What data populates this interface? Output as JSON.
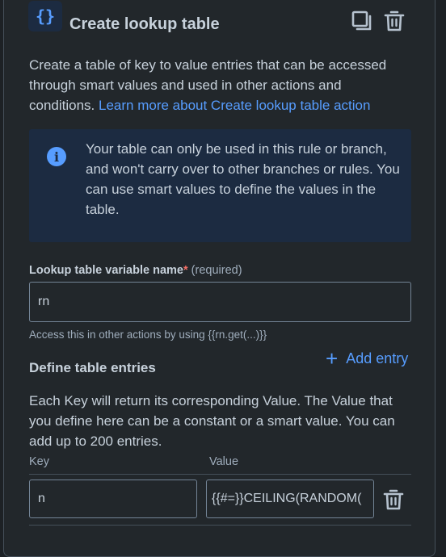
{
  "header": {
    "icon_glyph": "{}",
    "icon_name": "curly-braces-icon",
    "title": "Create lookup table"
  },
  "description": {
    "text": "Create a table of key to value entries that can be accessed through smart values and used in other actions and conditions. ",
    "link_text": "Learn more about Create lookup table action"
  },
  "info": {
    "icon_glyph": "i",
    "text": "Your table can only be used in this rule or branch, and won't carry over to other branches or rules. You can use smart values to define the values in the table."
  },
  "variable_field": {
    "label": "Lookup table variable name",
    "required_star": "*",
    "required_text": "(required)",
    "value": "rn",
    "helper": "Access this in other actions by using {{rn.get(...)}}"
  },
  "entries": {
    "title": "Define table entries",
    "add_label": "Add entry",
    "add_glyph": "+",
    "description": "Each Key will return its corresponding Value. The Value that you define here can be a constant or a smart value. You can add up to 200 entries.",
    "column_key": "Key",
    "column_value": "Value",
    "rows": [
      {
        "key": "n",
        "value": "{{#=}}CEILING(RANDOM("
      }
    ]
  },
  "colors": {
    "accent": "#579dff",
    "panel_bg": "#22272b",
    "info_bg": "#1c2b41",
    "required": "#f87168"
  }
}
